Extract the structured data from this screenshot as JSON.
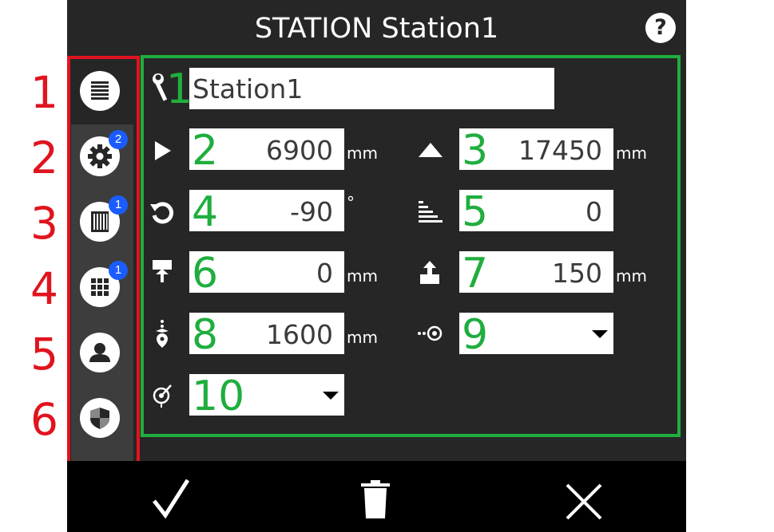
{
  "window": {
    "title": "STATION Station1",
    "help_label": "?"
  },
  "sidebar": {
    "red_numbers": [
      "1",
      "2",
      "3",
      "4",
      "5",
      "6"
    ],
    "items": [
      {
        "icon": "list-icon",
        "badge": ""
      },
      {
        "icon": "gear-icon",
        "badge": "2"
      },
      {
        "icon": "column-panel-icon",
        "badge": "1"
      },
      {
        "icon": "grid-icon",
        "badge": "1"
      },
      {
        "icon": "user-icon",
        "badge": ""
      },
      {
        "icon": "shield-icon",
        "badge": ""
      }
    ]
  },
  "form": {
    "name": {
      "marker": "1",
      "value": "Station1"
    },
    "fields": [
      {
        "marker": "2",
        "value": "6900",
        "unit": "mm",
        "icon": "play-right-icon"
      },
      {
        "marker": "3",
        "value": "17450",
        "unit": "mm",
        "icon": "triangle-up-icon"
      },
      {
        "marker": "4",
        "value": "-90",
        "unit": "°",
        "icon": "rotate-ccw-icon"
      },
      {
        "marker": "5",
        "value": "0",
        "unit": "",
        "icon": "stair-lines-icon"
      },
      {
        "marker": "6",
        "value": "0",
        "unit": "mm",
        "icon": "press-down-icon"
      },
      {
        "marker": "7",
        "value": "150",
        "unit": "mm",
        "icon": "lift-up-icon"
      },
      {
        "marker": "8",
        "value": "1600",
        "unit": "mm",
        "icon": "height-pin-icon"
      },
      {
        "marker": "9",
        "value": "",
        "unit": "",
        "icon": "target-point-icon"
      },
      {
        "marker": "10",
        "value": "",
        "unit": "",
        "icon": "sensor-icon"
      }
    ]
  },
  "colors": {
    "panel": "#262626",
    "sidebar": "#3d3d3d",
    "red_annotation": "#e0141e",
    "green_annotation": "#1fae3e",
    "badge": "#1a5cff"
  },
  "footer": {
    "confirm_icon": "check-icon",
    "delete_icon": "trash-icon",
    "close_icon": "close-icon"
  }
}
